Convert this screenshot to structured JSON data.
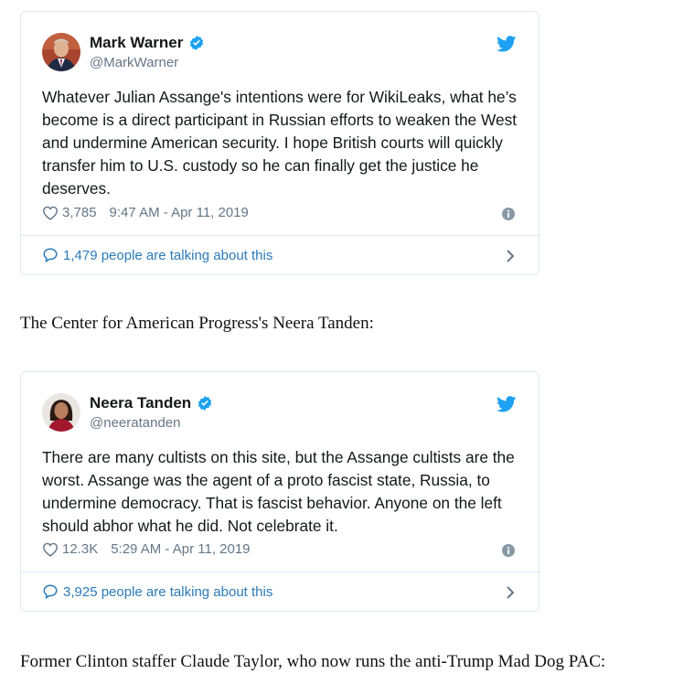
{
  "colors": {
    "verified_blue": "#1da1f2",
    "link_blue": "#2b7bb9",
    "muted_gray": "#657786",
    "border": "#e1e8ed"
  },
  "tweets": [
    {
      "display_name": "Mark Warner",
      "handle": "@MarkWarner",
      "text": "Whatever Julian Assange's intentions were for WikiLeaks, what he’s become is a direct participant in Russian efforts to weaken the West and undermine American security. I hope British courts will quickly transfer him to U.S. custody so he can finally get the justice he deserves.",
      "likes": "3,785",
      "timestamp": "9:47 AM - Apr 11, 2019",
      "talking": "1,479 people are talking about this",
      "icons": [
        "verified-badge-icon",
        "twitter-bird-icon",
        "heart-icon",
        "info-icon",
        "speech-bubble-icon",
        "chevron-right-icon"
      ]
    },
    {
      "display_name": "Neera Tanden",
      "handle": "@neeratanden",
      "text": "There are many cultists on this site, but the Assange cultists are the worst.  Assange was the agent of a proto fascist state, Russia, to undermine democracy. That is fascist behavior. Anyone on the left should abhor what he did. Not celebrate it.",
      "likes": "12.3K",
      "timestamp": "5:29 AM - Apr 11, 2019",
      "talking": "3,925 people are talking about this",
      "icons": [
        "verified-badge-icon",
        "twitter-bird-icon",
        "heart-icon",
        "info-icon",
        "speech-bubble-icon",
        "chevron-right-icon"
      ]
    }
  ],
  "captions": [
    "The Center for American Progress's Neera Tanden:",
    "Former Clinton staffer Claude Taylor, who now runs the anti-Trump Mad Dog PAC:"
  ]
}
